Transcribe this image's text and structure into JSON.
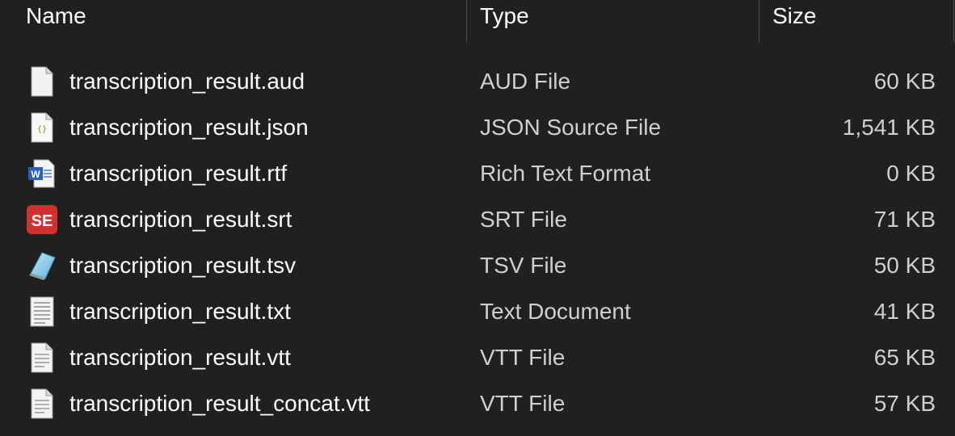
{
  "columns": {
    "name": "Name",
    "type": "Type",
    "size": "Size"
  },
  "files": [
    {
      "name": "transcription_result.aud",
      "type": "AUD File",
      "size": "60 KB",
      "icon": "generic-file-icon"
    },
    {
      "name": "transcription_result.json",
      "type": "JSON Source File",
      "size": "1,541 KB",
      "icon": "json-file-icon"
    },
    {
      "name": "transcription_result.rtf",
      "type": "Rich Text Format",
      "size": "0 KB",
      "icon": "word-document-icon"
    },
    {
      "name": "transcription_result.srt",
      "type": "SRT File",
      "size": "71 KB",
      "icon": "subtitle-edit-icon"
    },
    {
      "name": "transcription_result.tsv",
      "type": "TSV File",
      "size": "50 KB",
      "icon": "tsv-file-icon"
    },
    {
      "name": "transcription_result.txt",
      "type": "Text Document",
      "size": "41 KB",
      "icon": "text-document-icon"
    },
    {
      "name": "transcription_result.vtt",
      "type": "VTT File",
      "size": "65 KB",
      "icon": "generic-text-file-icon"
    },
    {
      "name": "transcription_result_concat.vtt",
      "type": "VTT File",
      "size": "57 KB",
      "icon": "generic-text-file-icon"
    }
  ],
  "colors": {
    "background": "#202020",
    "text": "#ffffff",
    "subtext": "#cfcfcf",
    "separator": "#4a4a4a",
    "srt_icon": "#d32f2f",
    "word_icon": "#2b5fbf"
  }
}
